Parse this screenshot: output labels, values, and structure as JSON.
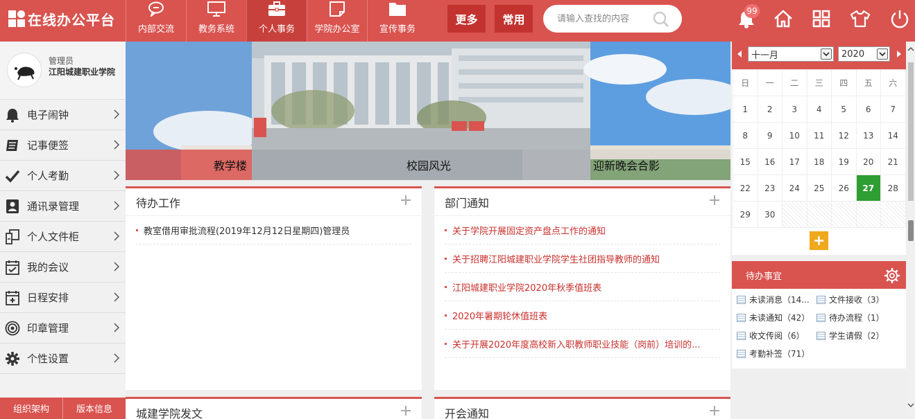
{
  "app": {
    "title": "在线办公平台"
  },
  "nav": {
    "items": [
      {
        "label": "内部交流",
        "icon": "chat-bubble-icon"
      },
      {
        "label": "教务系统",
        "icon": "monitor-icon"
      },
      {
        "label": "个人事务",
        "icon": "briefcase-icon",
        "active": true
      },
      {
        "label": "学院办公室",
        "icon": "note-icon"
      },
      {
        "label": "宣传事务",
        "icon": "folder-icon"
      }
    ],
    "more_label": "更多",
    "common_label": "常用"
  },
  "search": {
    "placeholder": "请输入查找的内容"
  },
  "header_icons": {
    "notification_count": "99"
  },
  "user": {
    "role": "管理员",
    "org": "江阳城建职业学院"
  },
  "sidebar": {
    "items": [
      {
        "label": "电子闹钟",
        "icon": "bell-icon"
      },
      {
        "label": "记事便签",
        "icon": "notebook-icon"
      },
      {
        "label": "个人考勤",
        "icon": "checkmark-icon"
      },
      {
        "label": "通讯录管理",
        "icon": "contact-card-icon"
      },
      {
        "label": "个人文件柜",
        "icon": "file-cabinet-icon"
      },
      {
        "label": "我的会议",
        "icon": "meeting-calendar-icon"
      },
      {
        "label": "日程安排",
        "icon": "schedule-add-icon"
      },
      {
        "label": "印章管理",
        "icon": "seal-icon"
      },
      {
        "label": "个性设置",
        "icon": "settings-gear-icon"
      }
    ],
    "bottom": {
      "org_chart": "组织架构",
      "version": "版本信息"
    }
  },
  "banner": {
    "captions": [
      "教学楼",
      "校园风光",
      "迎新晚会合影"
    ]
  },
  "panels": {
    "todo_work": {
      "title": "待办工作",
      "items": [
        "教室借用审批流程(2019年12月12日星期四)管理员"
      ]
    },
    "dept_notice": {
      "title": "部门通知",
      "items": [
        "关于学院开展固定资产盘点工作的通知",
        "关于招聘江阳城建职业学院学生社团指导教师的通知",
        "江阳城建职业学院2020年秋季值班表",
        "2020年暑期轮休值班表",
        "关于开展2020年度高校新入职教师职业技能（岗前）培训的..."
      ]
    },
    "college_docs": {
      "title": "城建学院发文"
    },
    "meeting_notice": {
      "title": "开会通知"
    }
  },
  "calendar": {
    "month": "十一月",
    "year": "2020",
    "weekdays": [
      "日",
      "一",
      "二",
      "三",
      "四",
      "五",
      "六"
    ],
    "weeks": [
      [
        "1",
        "2",
        "3",
        "4",
        "5",
        "6",
        "7"
      ],
      [
        "8",
        "9",
        "10",
        "11",
        "12",
        "13",
        "14"
      ],
      [
        "15",
        "16",
        "17",
        "18",
        "19",
        "20",
        "21"
      ],
      [
        "22",
        "23",
        "24",
        "25",
        "26",
        "27",
        "28"
      ],
      [
        "29",
        "30",
        "",
        "",
        "",
        "",
        ""
      ]
    ],
    "today": "27"
  },
  "todo_matters": {
    "title": "待办事宜",
    "items": [
      "未读消息（14...",
      "文件接收（3）",
      "未读通知（42）",
      "待办流程（1）",
      "收文传阅（6）",
      "学生请假（2）",
      "考勤补签（71）"
    ]
  },
  "colors": {
    "brand_red": "#d9534f",
    "today_green": "#2e9e32",
    "add_orange": "#f0a81c"
  }
}
